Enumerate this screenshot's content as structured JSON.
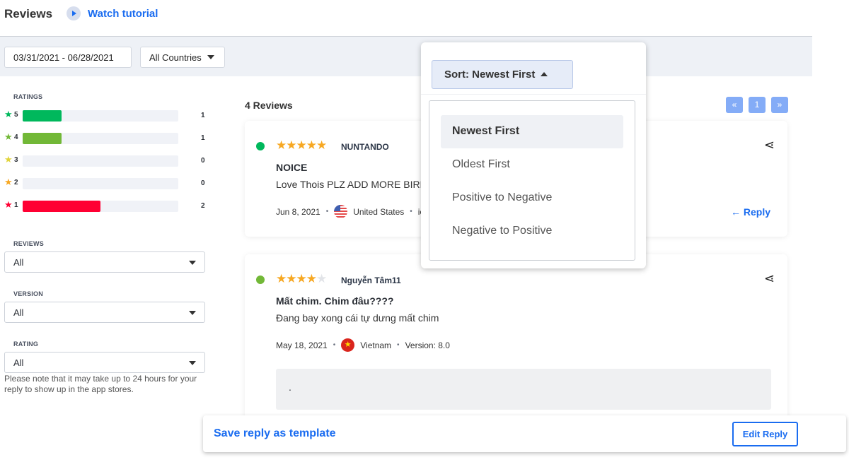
{
  "header": {
    "title": "Reviews",
    "tutorial_label": "Watch tutorial"
  },
  "filters": {
    "date_range": "03/31/2021 - 06/28/2021",
    "country": "All Countries"
  },
  "sidebar": {
    "ratings_label": "RATINGS",
    "ratings": [
      {
        "stars": "5",
        "count": "1",
        "fraction": 0.5,
        "color": "#00b85c"
      },
      {
        "stars": "4",
        "count": "1",
        "fraction": 0.5,
        "color": "#72b837"
      },
      {
        "stars": "3",
        "count": "0",
        "fraction": 0,
        "color": "#e1d43a"
      },
      {
        "stars": "2",
        "count": "0",
        "fraction": 0,
        "color": "#f7a823"
      },
      {
        "stars": "1",
        "count": "2",
        "fraction": 1,
        "color": "#ff0033"
      }
    ],
    "reviews_label": "REVIEWS",
    "reviews_value": "All",
    "version_label": "VERSION",
    "version_value": "All",
    "rating_label": "RATING",
    "rating_value": "All",
    "note": "Please note that it may take up to 24 hours for your reply to show up in the app stores."
  },
  "main": {
    "count": "4 Reviews",
    "pagination": {
      "prev": "«",
      "page": "1",
      "next": "»"
    },
    "reviews": [
      {
        "rating": 5,
        "author": "NUNTANDO",
        "title": "NOICE",
        "body": "Love Thois PLZ ADD MORE BIRD",
        "date": "Jun 8, 2021",
        "country": "United States",
        "version_partial": "io",
        "reply_label": "Reply"
      },
      {
        "rating": 4,
        "author": "Nguyễn Tâm11",
        "title": "Mất chim. Chim đâu????",
        "body": "Đang bay xong cái tự dưng mất chim",
        "date": "May 18, 2021",
        "country": "Vietnam",
        "version": "Version: 8.0",
        "reply_text": "."
      }
    ]
  },
  "sort": {
    "button": "Sort: Newest First",
    "options": [
      "Newest First",
      "Oldest First",
      "Positive to Negative",
      "Negative to Positive"
    ],
    "selected": "Newest First"
  },
  "bottom": {
    "save_template": "Save reply as template",
    "edit_reply": "Edit Reply"
  }
}
